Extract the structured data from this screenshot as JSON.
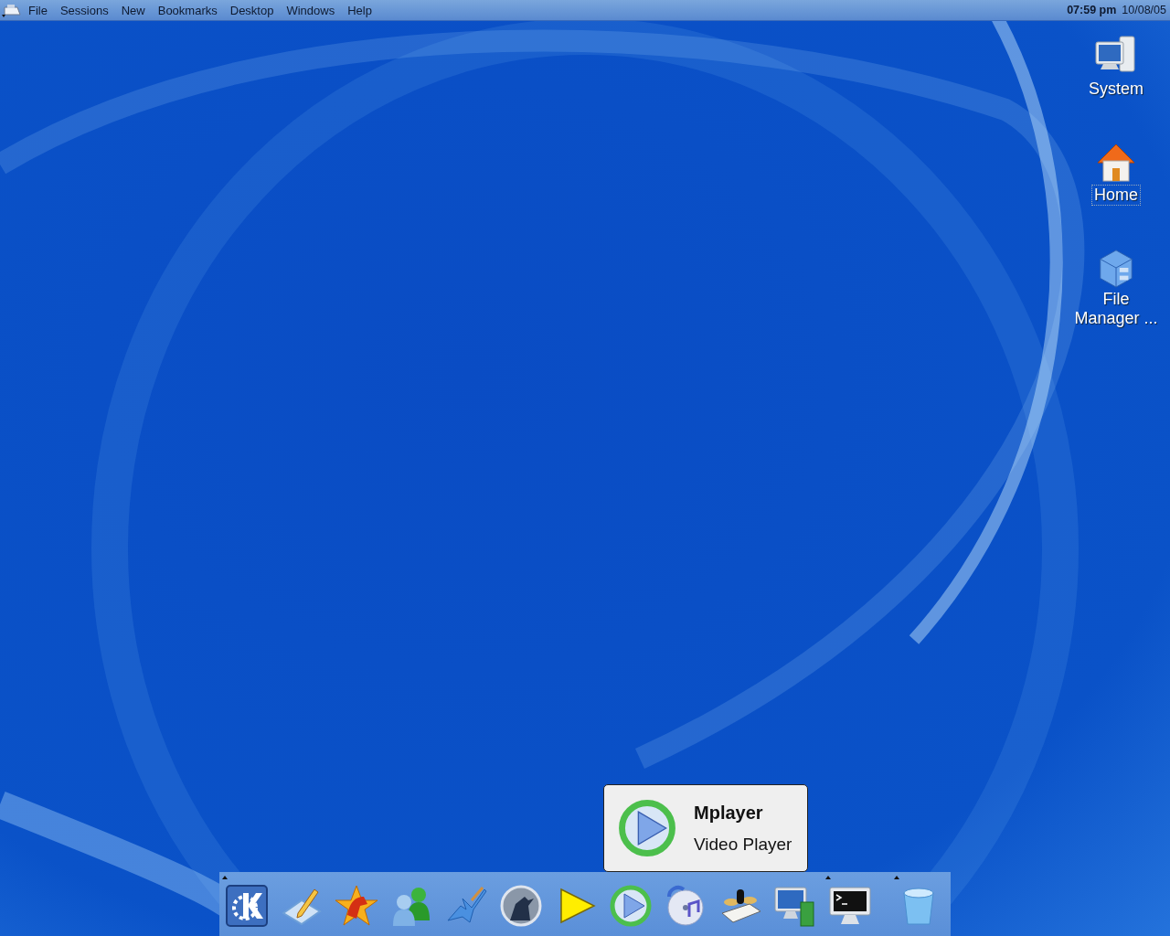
{
  "menu_bar": {
    "items": [
      "File",
      "Sessions",
      "New",
      "Bookmarks",
      "Desktop",
      "Windows",
      "Help"
    ]
  },
  "clock": {
    "time": "07:59 pm",
    "date": "10/08/05"
  },
  "desktop_icons": [
    {
      "kind": "computer",
      "label": "System",
      "selected": false
    },
    {
      "kind": "home",
      "label": "Home",
      "selected": true
    },
    {
      "kind": "cabinet",
      "label": "File Manager ...",
      "selected": false
    }
  ],
  "tooltip": {
    "kind": "play-ring",
    "title": "Mplayer",
    "subtitle": "Video Player"
  },
  "launchers": [
    {
      "kind": "kde",
      "has_menu": true
    },
    {
      "kind": "pencil",
      "has_menu": false
    },
    {
      "kind": "star",
      "has_menu": false
    },
    {
      "kind": "users",
      "has_menu": false
    },
    {
      "kind": "guitar",
      "has_menu": false
    },
    {
      "kind": "wolf",
      "has_menu": false
    },
    {
      "kind": "triangle",
      "has_menu": false
    },
    {
      "kind": "play-ring",
      "has_menu": false
    },
    {
      "kind": "disc",
      "has_menu": false
    },
    {
      "kind": "keyboard",
      "has_menu": false
    },
    {
      "kind": "monitor",
      "has_menu": false
    },
    {
      "kind": "terminal",
      "has_menu": true
    },
    {
      "kind": "trash",
      "has_menu": true
    }
  ]
}
